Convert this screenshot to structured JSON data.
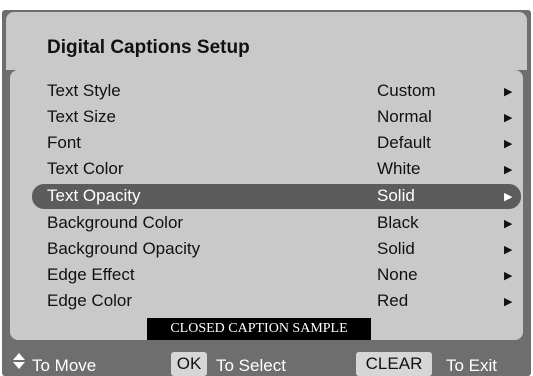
{
  "title": "Digital Captions Setup",
  "menu": {
    "items": [
      {
        "label": "Text Style",
        "value": "Custom",
        "arrow": "▶"
      },
      {
        "label": "Text Size",
        "value": "Normal",
        "arrow": "▶"
      },
      {
        "label": "Font",
        "value": "Default",
        "arrow": "▶"
      },
      {
        "label": "Text Color",
        "value": "White",
        "arrow": "▶"
      },
      {
        "label": "Text Opacity",
        "value": "Solid",
        "arrow": "▶",
        "selected": true
      },
      {
        "label": "Background Color",
        "value": "Black",
        "arrow": "▶"
      },
      {
        "label": "Background Opacity",
        "value": "Solid",
        "arrow": "▶"
      },
      {
        "label": "Edge Effect",
        "value": "None",
        "arrow": "▶"
      },
      {
        "label": "Edge Color",
        "value": "Red",
        "arrow": "▶"
      }
    ]
  },
  "sample": {
    "text": "CLOSED CAPTION SAMPLE"
  },
  "footer": {
    "move_label": "To Move",
    "ok_key": "OK",
    "select_label": "To Select",
    "clear_key": "CLEAR",
    "exit_label": "To Exit"
  },
  "colors": {
    "frame": "#6e6e6e",
    "panel": "#c9c9c9",
    "selection": "#5c5c5c"
  },
  "icons": {
    "move": "up-down-arrows-icon",
    "submenu": "right-triangle-icon"
  }
}
